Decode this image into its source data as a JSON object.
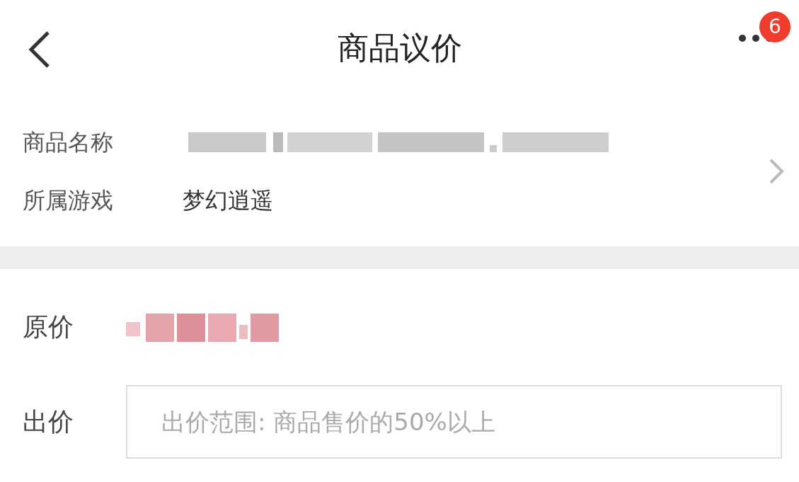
{
  "header": {
    "title": "商品议价",
    "badge": "6"
  },
  "info": [
    {
      "label": "商品名称"
    },
    {
      "label": "所属游戏",
      "value": "梦幻逍遥"
    }
  ],
  "price": {
    "label": "原价"
  },
  "offer": {
    "label": "出价",
    "placeholder": "出价范围: 商品售价的50%以上"
  }
}
